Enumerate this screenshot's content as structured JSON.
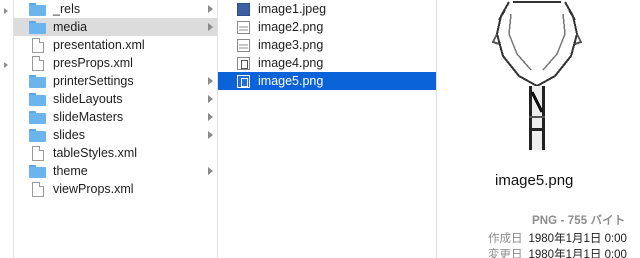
{
  "column1": {
    "items": [
      {
        "label": "_rels",
        "type": "folder",
        "has_children": true
      },
      {
        "label": "media",
        "type": "folder",
        "has_children": true,
        "selected": true
      },
      {
        "label": "presentation.xml",
        "type": "file",
        "has_children": false
      },
      {
        "label": "presProps.xml",
        "type": "file",
        "has_children": false
      },
      {
        "label": "printerSettings",
        "type": "folder",
        "has_children": true
      },
      {
        "label": "slideLayouts",
        "type": "folder",
        "has_children": true
      },
      {
        "label": "slideMasters",
        "type": "folder",
        "has_children": true
      },
      {
        "label": "slides",
        "type": "folder",
        "has_children": true
      },
      {
        "label": "tableStyles.xml",
        "type": "file",
        "has_children": false
      },
      {
        "label": "theme",
        "type": "folder",
        "has_children": true
      },
      {
        "label": "viewProps.xml",
        "type": "file",
        "has_children": false
      }
    ]
  },
  "column2": {
    "items": [
      {
        "label": "image1.jpeg",
        "icon": "jpeg-thumbnail-icon"
      },
      {
        "label": "image2.png",
        "icon": "png-thumbnail-icon"
      },
      {
        "label": "image3.png",
        "icon": "png-thumbnail-icon"
      },
      {
        "label": "image4.png",
        "icon": "png-thumbnail-icon"
      },
      {
        "label": "image5.png",
        "icon": "png-thumbnail-icon",
        "selected": true
      }
    ]
  },
  "preview": {
    "filename": "image5.png",
    "kind": "PNG - 755 バイト",
    "created_label": "作成日",
    "created_value": "1980年1月1日 0:00",
    "modified_label": "変更日",
    "modified_value": "1980年1月1日 0:00"
  },
  "colors": {
    "selection_blue": "#0a63d9",
    "selection_grey": "#dcdcdc",
    "folder_blue": "#6cb4ee"
  }
}
